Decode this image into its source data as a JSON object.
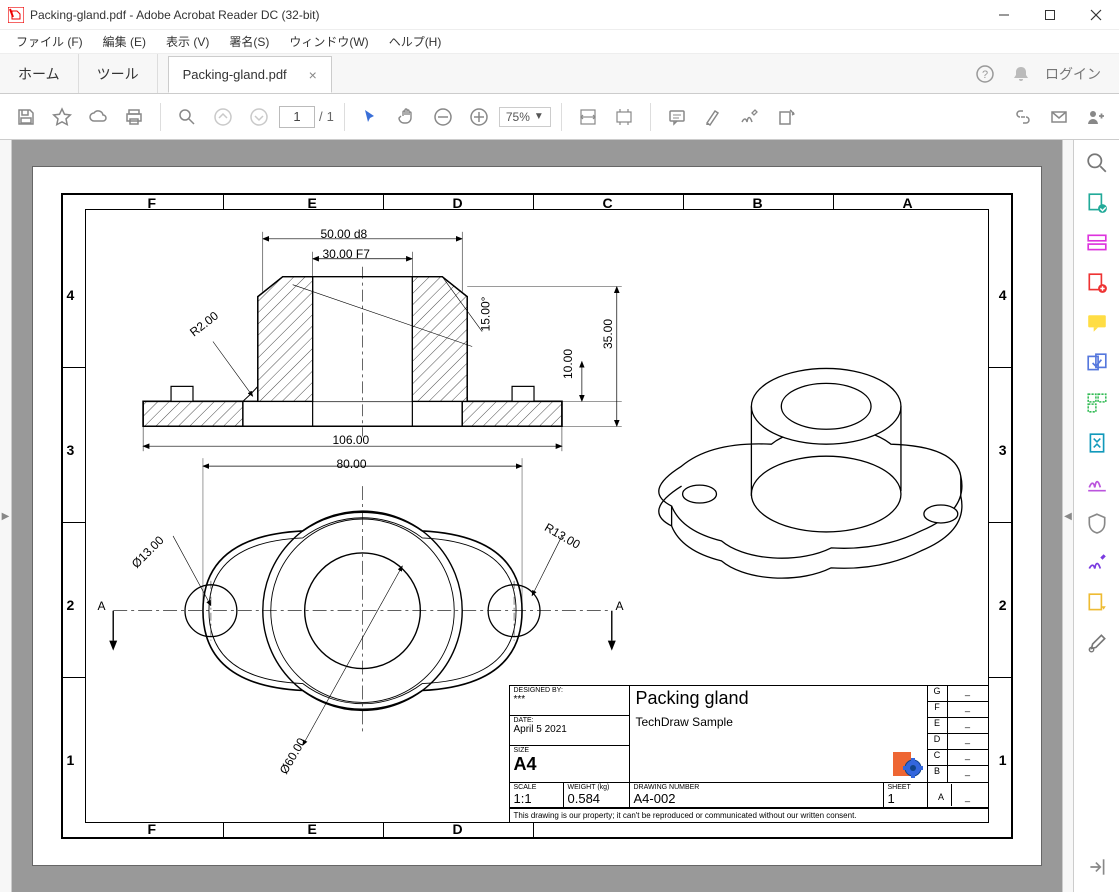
{
  "app": {
    "title": "Packing-gland.pdf - Adobe Acrobat Reader DC (32-bit)"
  },
  "menu": {
    "file": "ファイル (F)",
    "edit": "編集 (E)",
    "view": "表示 (V)",
    "sign": "署名(S)",
    "window": "ウィンドウ(W)",
    "help": "ヘルプ(H)"
  },
  "tabs": {
    "home": "ホーム",
    "tools": "ツール",
    "doc_tab": "Packing-gland.pdf",
    "login": "ログイン"
  },
  "toolbar": {
    "page_current": "1",
    "page_sep": "/",
    "page_total": "1",
    "zoom": "75%"
  },
  "drawing": {
    "columns": [
      "F",
      "E",
      "D",
      "C",
      "B",
      "A"
    ],
    "rows": [
      "4",
      "3",
      "2",
      "1"
    ],
    "dims": {
      "d5000": "50.00  d8",
      "d3000": "30.00  F7",
      "r200": "R2.00",
      "a1500": "15.00°",
      "d1000": "10.00",
      "d3500": "35.00",
      "d10600": "106.00",
      "d8000": "80.00",
      "dia1300": "Ø13.00",
      "r1300": "R13.00",
      "dia6000": "Ø60.00",
      "sectA1": "A",
      "sectA2": "A"
    },
    "title_block": {
      "designed_by_label": "DESIGNED BY:",
      "designed_by": "***",
      "date_label": "DATE:",
      "date": "April 5 2021",
      "size_label": "SIZE",
      "size": "A4",
      "title": "Packing gland",
      "subtitle": "TechDraw Sample",
      "scale_label": "SCALE",
      "scale": "1:1",
      "weight_label": "WEIGHT (kg)",
      "weight": "0.584",
      "dwgno_label": "DRAWING NUMBER",
      "dwgno": "A4-002",
      "sheet_label": "SHEET",
      "sheet": "1",
      "rev_G": "G",
      "rev_F": "F",
      "rev_E": "E",
      "rev_D": "D",
      "rev_C": "C",
      "rev_B": "B",
      "rev_A": "A",
      "dash": "_",
      "note": "This drawing is our property; it can't be reproduced or communicated without our written consent."
    }
  }
}
